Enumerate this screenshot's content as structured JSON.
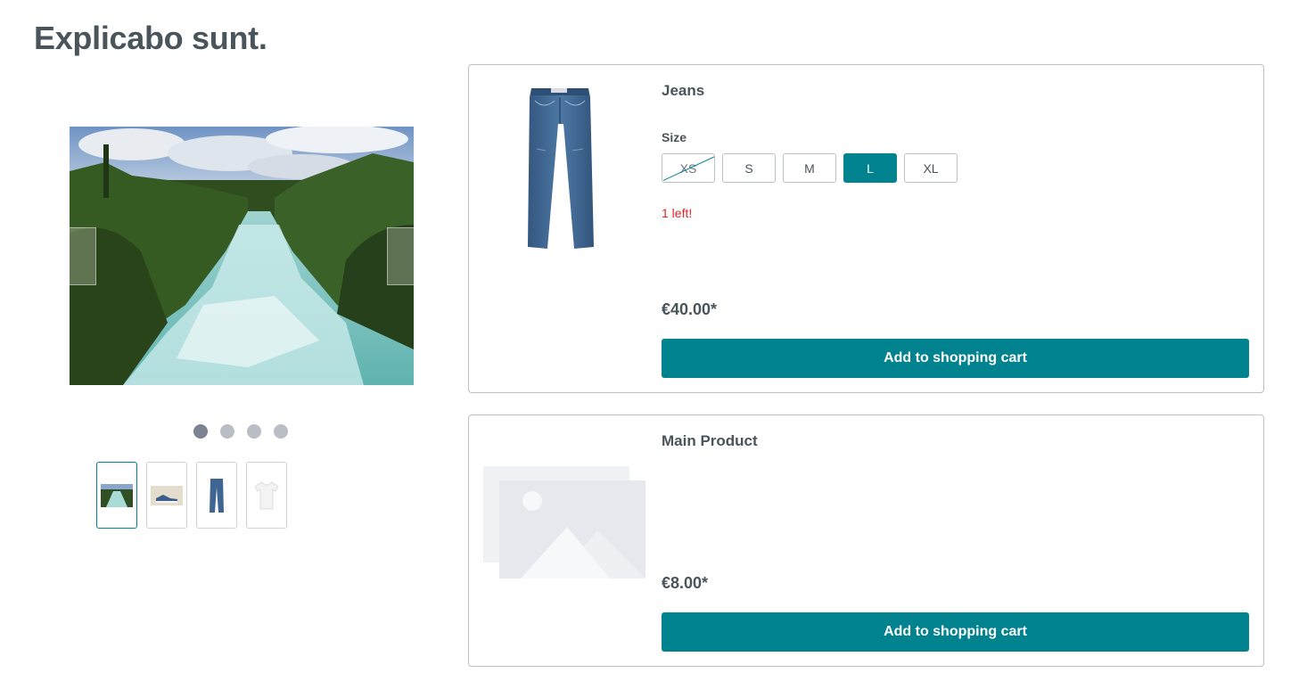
{
  "page": {
    "title": "Explicabo sunt."
  },
  "gallery": {
    "prev_icon": "chevron-left-icon",
    "next_icon": "chevron-right-icon",
    "dots_count": 4,
    "active_dot": 0,
    "thumbnails": [
      "waterfall",
      "shoe",
      "jeans",
      "t-shirt"
    ],
    "active_thumbnail": 0
  },
  "products": [
    {
      "name": "Jeans",
      "size_label": "Size",
      "sizes": [
        {
          "label": "XS",
          "available": false,
          "selected": false
        },
        {
          "label": "S",
          "available": true,
          "selected": false
        },
        {
          "label": "M",
          "available": true,
          "selected": false
        },
        {
          "label": "L",
          "available": true,
          "selected": true
        },
        {
          "label": "XL",
          "available": true,
          "selected": false
        }
      ],
      "stock": "1 left!",
      "price": "€40.00*",
      "cart_label": "Add to shopping cart"
    },
    {
      "name": "Main Product",
      "image": "placeholder-image-icon",
      "price": "€8.00*",
      "cart_label": "Add to shopping cart"
    }
  ],
  "colors": {
    "accent": "#00838f",
    "text": "#4a545b",
    "stock_warning": "#e52427"
  }
}
